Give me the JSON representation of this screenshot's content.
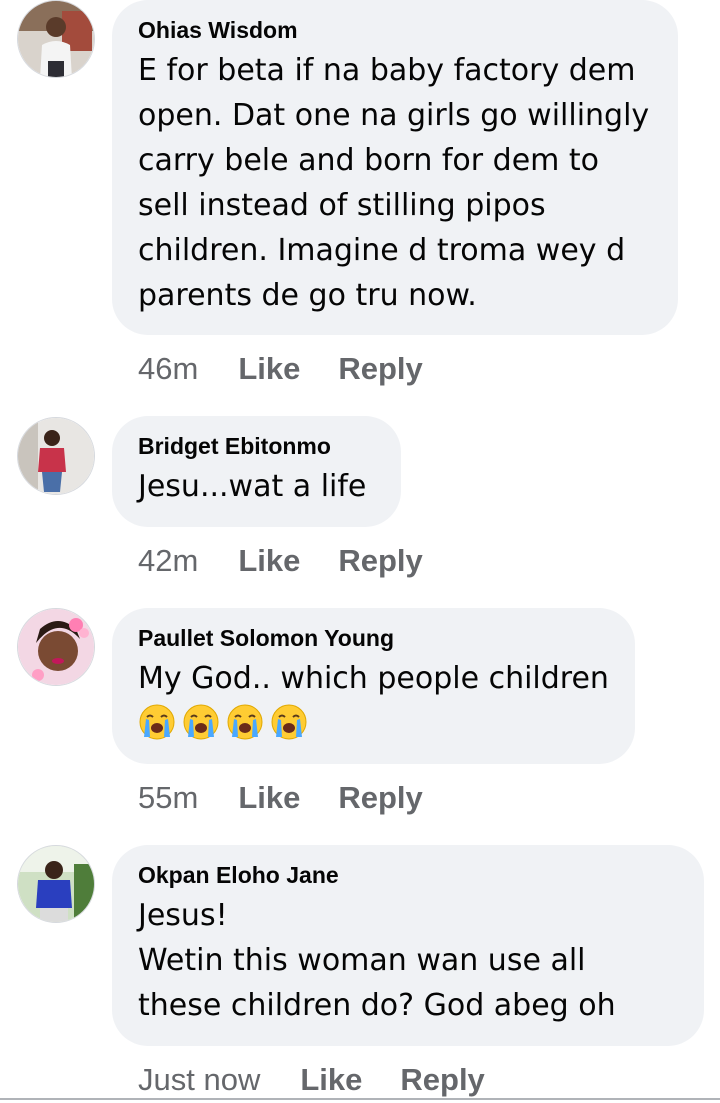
{
  "comments": [
    {
      "author": "Ohias Wisdom",
      "text": "E for beta if na baby factory dem open. Dat one na girls go willingly carry bele and born for dem to sell instead of stilling pipos children. Imagine d troma wey d parents de go tru now.",
      "time": "46m",
      "like_label": "Like",
      "reply_label": "Reply"
    },
    {
      "author": "Bridget Ebitonmo",
      "text": "Jesu...wat a life",
      "time": "42m",
      "like_label": "Like",
      "reply_label": "Reply"
    },
    {
      "author": "Paullet Solomon Young",
      "text": "My God.. which people children",
      "emojis": [
        "crying-face-emoji",
        "crying-face-emoji",
        "crying-face-emoji",
        "crying-face-emoji"
      ],
      "time": "55m",
      "like_label": "Like",
      "reply_label": "Reply"
    },
    {
      "author": "Okpan Eloho Jane",
      "text": "Jesus!\nWetin this woman wan use all these children do? God abeg oh",
      "time": "Just now",
      "like_label": "Like",
      "reply_label": "Reply"
    }
  ],
  "colors": {
    "bubble_bg": "#f0f2f5",
    "meta_text": "#65676b",
    "body_text": "#050505"
  }
}
